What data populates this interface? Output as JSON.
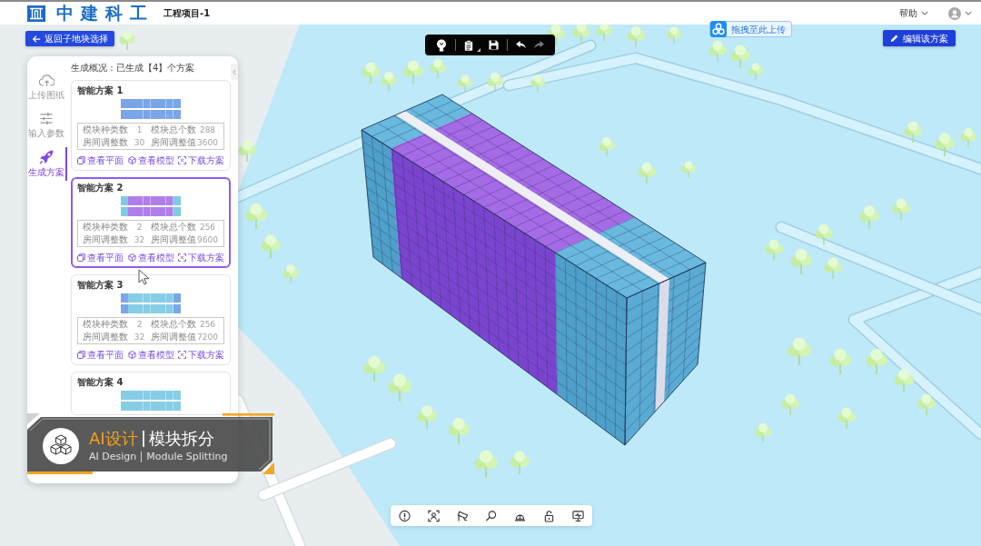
{
  "header": {
    "logo_text": "中建科工",
    "project": "工程项目-1",
    "help": "帮助"
  },
  "back_button": "返回子地块选择",
  "toolbar": {
    "undo": {
      "disabled": false
    },
    "redo": {
      "disabled": true
    }
  },
  "upload_chip": "拖拽至此上传",
  "edit_button": "编辑该方案",
  "sidebar": {
    "items": [
      {
        "label": "上传图纸",
        "selected": false
      },
      {
        "label": "输入参数",
        "selected": false
      },
      {
        "label": "生成方案",
        "selected": true
      }
    ]
  },
  "summary": "生成概况：已生成【4】个方案",
  "cards": [
    {
      "title": "智能方案 1",
      "selected": false,
      "preview": {
        "ends": {
          "color": "#79a6ea"
        },
        "middle": {
          "color": "#79a6ea"
        }
      },
      "stats": [
        {
          "label": "模块种类数",
          "value": "1"
        },
        {
          "label": "模块总个数",
          "value": "288"
        },
        {
          "label": "房间调整数",
          "value": "30"
        },
        {
          "label": "房间调整值",
          "value": "3600"
        }
      ],
      "actions": [
        "查看平面",
        "查看模型",
        "下载方案"
      ]
    },
    {
      "title": "智能方案 2",
      "selected": true,
      "preview": {
        "ends": {
          "color": "#7ecbe3"
        },
        "middle": {
          "color": "#b07ee8"
        }
      },
      "stats": [
        {
          "label": "模块种类数",
          "value": "2"
        },
        {
          "label": "模块总个数",
          "value": "256"
        },
        {
          "label": "房间调整数",
          "value": "32"
        },
        {
          "label": "房间调整值",
          "value": "9600"
        }
      ],
      "actions": [
        "查看平面",
        "查看模型",
        "下载方案"
      ]
    },
    {
      "title": "智能方案 3",
      "selected": false,
      "preview": {
        "ends": {
          "color": "#7ba6ea"
        },
        "middle": {
          "color": "#86cde6"
        }
      },
      "stats": [
        {
          "label": "模块种类数",
          "value": "2"
        },
        {
          "label": "模块总个数",
          "value": "256"
        },
        {
          "label": "房间调整数",
          "value": "32"
        },
        {
          "label": "房间调整值",
          "value": "7200"
        }
      ],
      "actions": [
        "查看平面",
        "查看模型",
        "下载方案"
      ]
    },
    {
      "title": "智能方案 4",
      "selected": false,
      "preview": {
        "ends": {
          "color": "#86cde6"
        },
        "middle": {
          "color": "#86cde6"
        }
      }
    }
  ],
  "banner": {
    "title": "AI设计",
    "subtitle": "模块拆分",
    "title_en": "AI Design",
    "subtitle_en": "Module Splitting"
  }
}
